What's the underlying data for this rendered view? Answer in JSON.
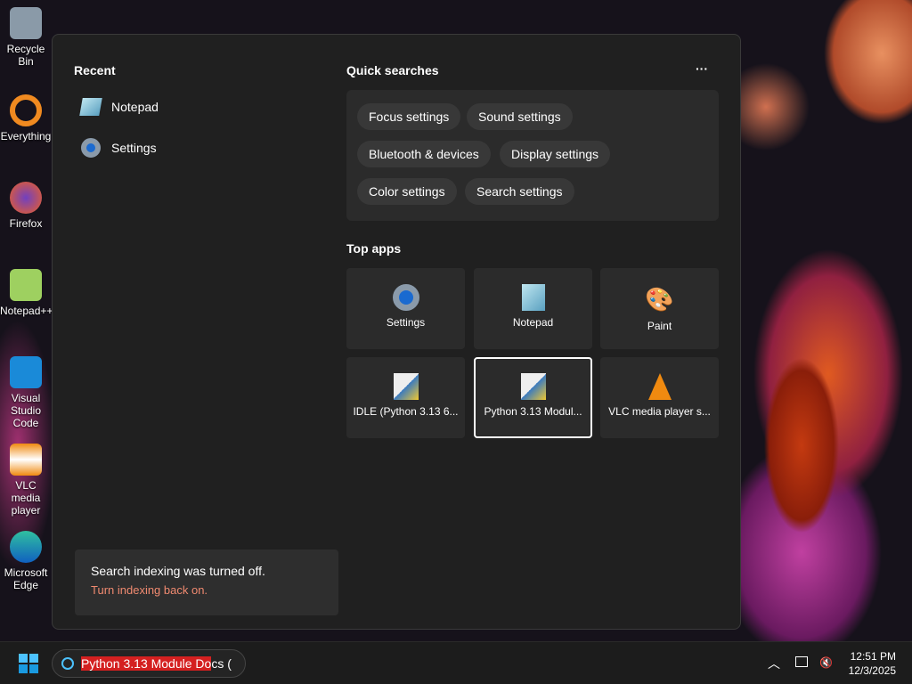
{
  "desktop": {
    "icons": [
      {
        "label": "Recycle Bin"
      },
      {
        "label": "Everything"
      },
      {
        "label": "Firefox"
      },
      {
        "label": "Notepad++"
      },
      {
        "label": "Visual Studio Code"
      },
      {
        "label": "VLC media player"
      },
      {
        "label": "Microsoft Edge"
      }
    ]
  },
  "start": {
    "recent_title": "Recent",
    "recent": [
      {
        "label": "Notepad",
        "icon": "notepad-icon"
      },
      {
        "label": "Settings",
        "icon": "gear-icon"
      }
    ],
    "quick_title": "Quick searches",
    "more": "···",
    "quick": [
      "Focus settings",
      "Sound settings",
      "Bluetooth & devices",
      "Display settings",
      "Color settings",
      "Search settings"
    ],
    "top_title": "Top apps",
    "top_apps": [
      {
        "label": "Settings",
        "icon": "gear-icon"
      },
      {
        "label": "Notepad",
        "icon": "notepad-icon"
      },
      {
        "label": "Paint",
        "icon": "palette-icon"
      },
      {
        "label": "IDLE (Python 3.13 6...",
        "icon": "python-icon"
      },
      {
        "label": "Python 3.13 Modul...",
        "icon": "python-icon"
      },
      {
        "label": "VLC media player s...",
        "icon": "vlc-icon"
      }
    ],
    "notice": {
      "text": "Search indexing was turned off.",
      "link": "Turn indexing back on."
    }
  },
  "taskbar": {
    "search_selected": "Python 3.13 Module Do",
    "search_rest": "cs (",
    "time": "12:51 PM",
    "date": "12/3/2025"
  },
  "colors": {
    "accent_link": "#f08a70",
    "selection": "#d42020"
  }
}
